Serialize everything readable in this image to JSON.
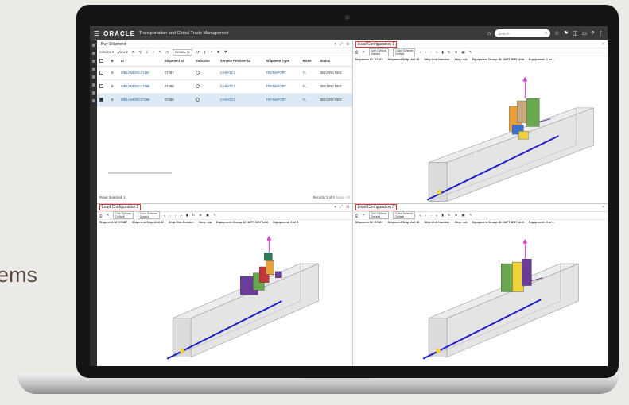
{
  "slide": {
    "partial_text": "ems"
  },
  "app": {
    "logo": "ORACLE",
    "title": "Transportation and Global Trade Management",
    "search_placeholder": "Search"
  },
  "buy_shipment": {
    "title": "Buy Shipment",
    "actions_label": "Actions",
    "view_label": "View",
    "select_value": "BC000ef",
    "columns": [
      "ID",
      "Shipment ID",
      "Indicator",
      "Service Provider ID",
      "Shipment Type",
      "Mode",
      "Status"
    ],
    "rows": [
      {
        "id": "WBLANDSN.07487",
        "shipment_id": "07487",
        "provider": "CARATC1",
        "type": "TRANSPORT",
        "mode": "TL",
        "status": "SECURE RES",
        "checked": false,
        "selected": false
      },
      {
        "id": "WBLANDSN.07488",
        "shipment_id": "07488",
        "provider": "CARATC1",
        "type": "TRANSPORT",
        "mode": "TL",
        "status": "SECURE RES",
        "checked": false,
        "selected": false
      },
      {
        "id": "WBLANDSN.07489",
        "shipment_id": "07489",
        "provider": "CARATC1",
        "type": "TRANSPORT",
        "mode": "TL",
        "status": "SECURE RES",
        "checked": true,
        "selected": true
      }
    ],
    "rows_selected": "Rows Selected: 1",
    "records": "Records 3 of 3",
    "more": "More",
    "all": "All"
  },
  "load_config": {
    "pane1_title": "Load Configuration 1",
    "pane2_title": "Load Configuration 2",
    "pane3_title": "Load Configuration 3",
    "sel1_label": "Use Options",
    "sel1_value": "Default",
    "sel2_label": "Color Scheme",
    "sel2_value": "Default",
    "info": [
      "Shipment ID: 07487",
      "Shipment Ship Unit ID",
      "Ship Unit Number",
      "Step: n/a",
      "Equipment Group ID: 40FT DRY Unit",
      "Equipment: 1 of 1"
    ]
  },
  "colors": {
    "header": "#3c3a38",
    "container_fill": "#e6e6e6",
    "axis_blue": "#1e1ec8",
    "box_orange": "#e8a13a",
    "box_green": "#6aa84f",
    "box_purple": "#6a3d9a",
    "box_tan": "#c8a97e",
    "box_yellow": "#f0d23a",
    "box_blue": "#3a6fd0",
    "highlight_red": "#d23a3a"
  }
}
